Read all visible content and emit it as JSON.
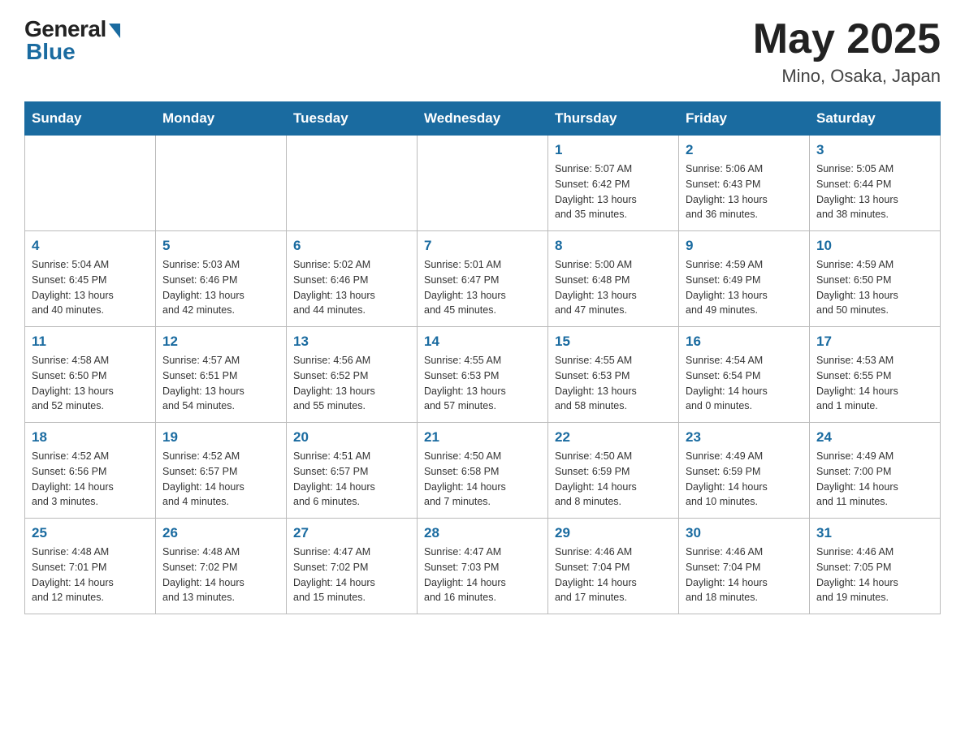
{
  "logo": {
    "text_general": "General",
    "text_blue": "Blue"
  },
  "header": {
    "title": "May 2025",
    "subtitle": "Mino, Osaka, Japan"
  },
  "weekdays": [
    "Sunday",
    "Monday",
    "Tuesday",
    "Wednesday",
    "Thursday",
    "Friday",
    "Saturday"
  ],
  "weeks": [
    [
      {
        "day": "",
        "info": ""
      },
      {
        "day": "",
        "info": ""
      },
      {
        "day": "",
        "info": ""
      },
      {
        "day": "",
        "info": ""
      },
      {
        "day": "1",
        "info": "Sunrise: 5:07 AM\nSunset: 6:42 PM\nDaylight: 13 hours\nand 35 minutes."
      },
      {
        "day": "2",
        "info": "Sunrise: 5:06 AM\nSunset: 6:43 PM\nDaylight: 13 hours\nand 36 minutes."
      },
      {
        "day": "3",
        "info": "Sunrise: 5:05 AM\nSunset: 6:44 PM\nDaylight: 13 hours\nand 38 minutes."
      }
    ],
    [
      {
        "day": "4",
        "info": "Sunrise: 5:04 AM\nSunset: 6:45 PM\nDaylight: 13 hours\nand 40 minutes."
      },
      {
        "day": "5",
        "info": "Sunrise: 5:03 AM\nSunset: 6:46 PM\nDaylight: 13 hours\nand 42 minutes."
      },
      {
        "day": "6",
        "info": "Sunrise: 5:02 AM\nSunset: 6:46 PM\nDaylight: 13 hours\nand 44 minutes."
      },
      {
        "day": "7",
        "info": "Sunrise: 5:01 AM\nSunset: 6:47 PM\nDaylight: 13 hours\nand 45 minutes."
      },
      {
        "day": "8",
        "info": "Sunrise: 5:00 AM\nSunset: 6:48 PM\nDaylight: 13 hours\nand 47 minutes."
      },
      {
        "day": "9",
        "info": "Sunrise: 4:59 AM\nSunset: 6:49 PM\nDaylight: 13 hours\nand 49 minutes."
      },
      {
        "day": "10",
        "info": "Sunrise: 4:59 AM\nSunset: 6:50 PM\nDaylight: 13 hours\nand 50 minutes."
      }
    ],
    [
      {
        "day": "11",
        "info": "Sunrise: 4:58 AM\nSunset: 6:50 PM\nDaylight: 13 hours\nand 52 minutes."
      },
      {
        "day": "12",
        "info": "Sunrise: 4:57 AM\nSunset: 6:51 PM\nDaylight: 13 hours\nand 54 minutes."
      },
      {
        "day": "13",
        "info": "Sunrise: 4:56 AM\nSunset: 6:52 PM\nDaylight: 13 hours\nand 55 minutes."
      },
      {
        "day": "14",
        "info": "Sunrise: 4:55 AM\nSunset: 6:53 PM\nDaylight: 13 hours\nand 57 minutes."
      },
      {
        "day": "15",
        "info": "Sunrise: 4:55 AM\nSunset: 6:53 PM\nDaylight: 13 hours\nand 58 minutes."
      },
      {
        "day": "16",
        "info": "Sunrise: 4:54 AM\nSunset: 6:54 PM\nDaylight: 14 hours\nand 0 minutes."
      },
      {
        "day": "17",
        "info": "Sunrise: 4:53 AM\nSunset: 6:55 PM\nDaylight: 14 hours\nand 1 minute."
      }
    ],
    [
      {
        "day": "18",
        "info": "Sunrise: 4:52 AM\nSunset: 6:56 PM\nDaylight: 14 hours\nand 3 minutes."
      },
      {
        "day": "19",
        "info": "Sunrise: 4:52 AM\nSunset: 6:57 PM\nDaylight: 14 hours\nand 4 minutes."
      },
      {
        "day": "20",
        "info": "Sunrise: 4:51 AM\nSunset: 6:57 PM\nDaylight: 14 hours\nand 6 minutes."
      },
      {
        "day": "21",
        "info": "Sunrise: 4:50 AM\nSunset: 6:58 PM\nDaylight: 14 hours\nand 7 minutes."
      },
      {
        "day": "22",
        "info": "Sunrise: 4:50 AM\nSunset: 6:59 PM\nDaylight: 14 hours\nand 8 minutes."
      },
      {
        "day": "23",
        "info": "Sunrise: 4:49 AM\nSunset: 6:59 PM\nDaylight: 14 hours\nand 10 minutes."
      },
      {
        "day": "24",
        "info": "Sunrise: 4:49 AM\nSunset: 7:00 PM\nDaylight: 14 hours\nand 11 minutes."
      }
    ],
    [
      {
        "day": "25",
        "info": "Sunrise: 4:48 AM\nSunset: 7:01 PM\nDaylight: 14 hours\nand 12 minutes."
      },
      {
        "day": "26",
        "info": "Sunrise: 4:48 AM\nSunset: 7:02 PM\nDaylight: 14 hours\nand 13 minutes."
      },
      {
        "day": "27",
        "info": "Sunrise: 4:47 AM\nSunset: 7:02 PM\nDaylight: 14 hours\nand 15 minutes."
      },
      {
        "day": "28",
        "info": "Sunrise: 4:47 AM\nSunset: 7:03 PM\nDaylight: 14 hours\nand 16 minutes."
      },
      {
        "day": "29",
        "info": "Sunrise: 4:46 AM\nSunset: 7:04 PM\nDaylight: 14 hours\nand 17 minutes."
      },
      {
        "day": "30",
        "info": "Sunrise: 4:46 AM\nSunset: 7:04 PM\nDaylight: 14 hours\nand 18 minutes."
      },
      {
        "day": "31",
        "info": "Sunrise: 4:46 AM\nSunset: 7:05 PM\nDaylight: 14 hours\nand 19 minutes."
      }
    ]
  ]
}
